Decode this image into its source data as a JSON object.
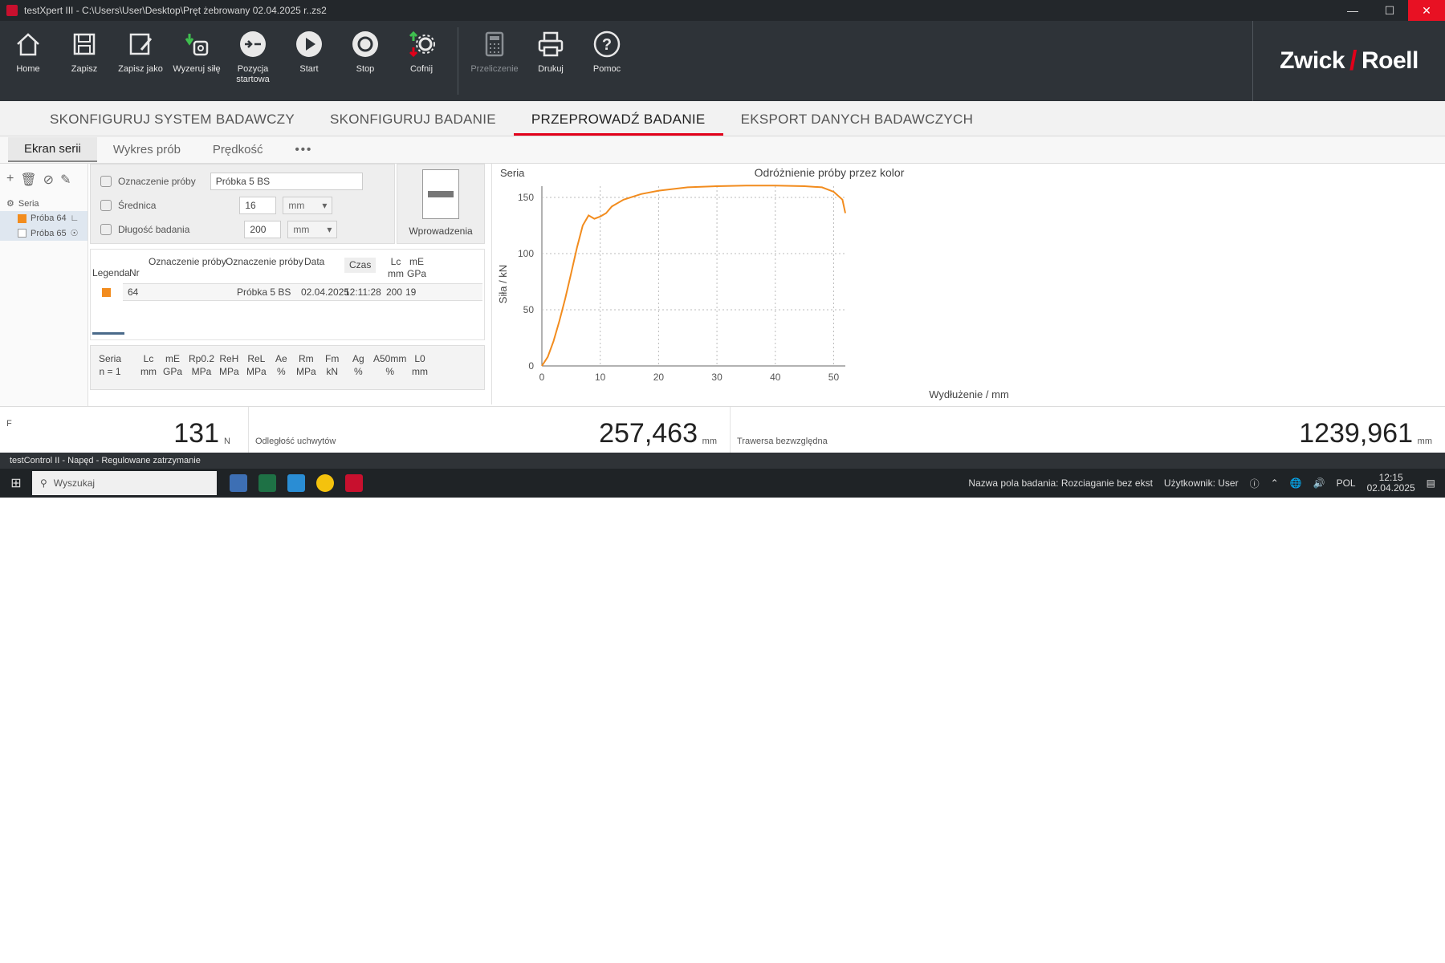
{
  "window": {
    "title": "testXpert III - C:\\Users\\User\\Desktop\\Pręt żebrowany 02.04.2025 r..zs2"
  },
  "toolbar": {
    "buttons": [
      {
        "label": "Home",
        "icon": "home-icon"
      },
      {
        "label": "Zapisz",
        "icon": "save-icon"
      },
      {
        "label": "Zapisz jako",
        "icon": "save-as-icon"
      },
      {
        "label": "Wyzeruj siłę",
        "icon": "zero-force-icon"
      },
      {
        "label": "Pozycja startowa",
        "icon": "start-position-icon"
      },
      {
        "label": "Start",
        "icon": "play-icon"
      },
      {
        "label": "Stop",
        "icon": "stop-icon"
      },
      {
        "label": "Cofnij",
        "icon": "undo-gear-icon"
      },
      {
        "label": "Przeliczenie",
        "icon": "recalc-icon"
      },
      {
        "label": "Drukuj",
        "icon": "printer-icon"
      },
      {
        "label": "Pomoc",
        "icon": "help-icon"
      }
    ],
    "brand": {
      "left": "Zwick",
      "right": "Roell",
      "accent": "#e2001a"
    }
  },
  "main_tabs": [
    "SKONFIGURUJ SYSTEM BADAWCZY",
    "SKONFIGURUJ BADANIE",
    "PRZEPROWADŹ BADANIE",
    "EKSPORT DANYCH BADAWCZYCH"
  ],
  "sub_tabs": [
    "Ekran serii",
    "Wykres prób",
    "Prędkość",
    "•••"
  ],
  "tree": {
    "root": "Seria",
    "items": [
      {
        "label": "Próba 64"
      },
      {
        "label": "Próba 65"
      }
    ]
  },
  "params": {
    "specimen_label": "Oznaczenie próby",
    "specimen_value": "Próbka 5 BS",
    "diameter_label": "Średnica",
    "diameter_value": "16",
    "diameter_unit": "mm",
    "length_label": "Długość badania",
    "length_value": "200",
    "length_unit": "mm",
    "intro_label": "Wprowadzenia"
  },
  "results": {
    "headers": {
      "legend": "Legenda",
      "nr": "Nr",
      "oznaczenie1": "Oznaczenie próby",
      "oznaczenie2": "Oznaczenie próby",
      "data": "Data",
      "czas": "Czas",
      "lc": "Lc",
      "lc_unit": "mm",
      "me": "mE",
      "me_unit": "GPa"
    },
    "row": {
      "nr": "64",
      "oznaczenie": "Próbka 5 BS",
      "data": "02.04.2025",
      "czas": "12:11:28",
      "lc": "200",
      "me": "19"
    }
  },
  "stats": {
    "seria": "Seria",
    "n": "n = 1",
    "cols": [
      {
        "name": "Lc",
        "unit": "mm"
      },
      {
        "name": "mE",
        "unit": "GPa"
      },
      {
        "name": "Rp0.2",
        "unit": "MPa"
      },
      {
        "name": "ReH",
        "unit": "MPa"
      },
      {
        "name": "ReL",
        "unit": "MPa"
      },
      {
        "name": "Ae",
        "unit": "%"
      },
      {
        "name": "Rm",
        "unit": "MPa"
      },
      {
        "name": "Fm",
        "unit": "kN"
      },
      {
        "name": "Ag",
        "unit": "%"
      },
      {
        "name": "A50mm",
        "unit": "%"
      },
      {
        "name": "L0",
        "unit": "mm"
      }
    ]
  },
  "chart_data": {
    "type": "line",
    "panel_label": "Seria",
    "title": "Odróżnienie próby przez kolor",
    "xlabel": "Wydłużenie / mm",
    "ylabel": "Siła / kN",
    "xlim": [
      0,
      52
    ],
    "ylim": [
      0,
      160
    ],
    "xticks": [
      0,
      10,
      20,
      30,
      40,
      50
    ],
    "yticks": [
      0,
      50,
      100,
      150
    ],
    "grid": true,
    "color": "#f28c1e",
    "series": [
      {
        "x": [
          0,
          1,
          2,
          3,
          4,
          5,
          6,
          7,
          8,
          9,
          10,
          11,
          12,
          14,
          17,
          20,
          25,
          30,
          35,
          40,
          45,
          48,
          50,
          51.5,
          52
        ],
        "y": [
          0,
          8,
          22,
          40,
          60,
          82,
          105,
          125,
          134,
          131,
          133,
          136,
          142,
          148,
          153,
          156,
          159,
          160,
          160.5,
          160.5,
          160,
          159,
          155,
          148,
          136
        ]
      }
    ]
  },
  "readouts": {
    "force_label": "F",
    "force_value": "131",
    "force_unit": "N",
    "grip_label": "Odległość uchwytów",
    "grip_value": "257,463",
    "grip_unit": "mm",
    "crosshead_label": "Trawersa bezwzględna",
    "crosshead_value": "1239,961",
    "crosshead_unit": "mm"
  },
  "status": {
    "left": "testControl II - Napęd - Regulowane zatrzymanie",
    "field": "Nazwa pola badania: Rozciaganie bez ekst",
    "user": "Użytkownik: User"
  },
  "taskbar": {
    "search_placeholder": "Wyszukaj",
    "lang": "POL",
    "time": "12:15",
    "date": "02.04.2025"
  }
}
